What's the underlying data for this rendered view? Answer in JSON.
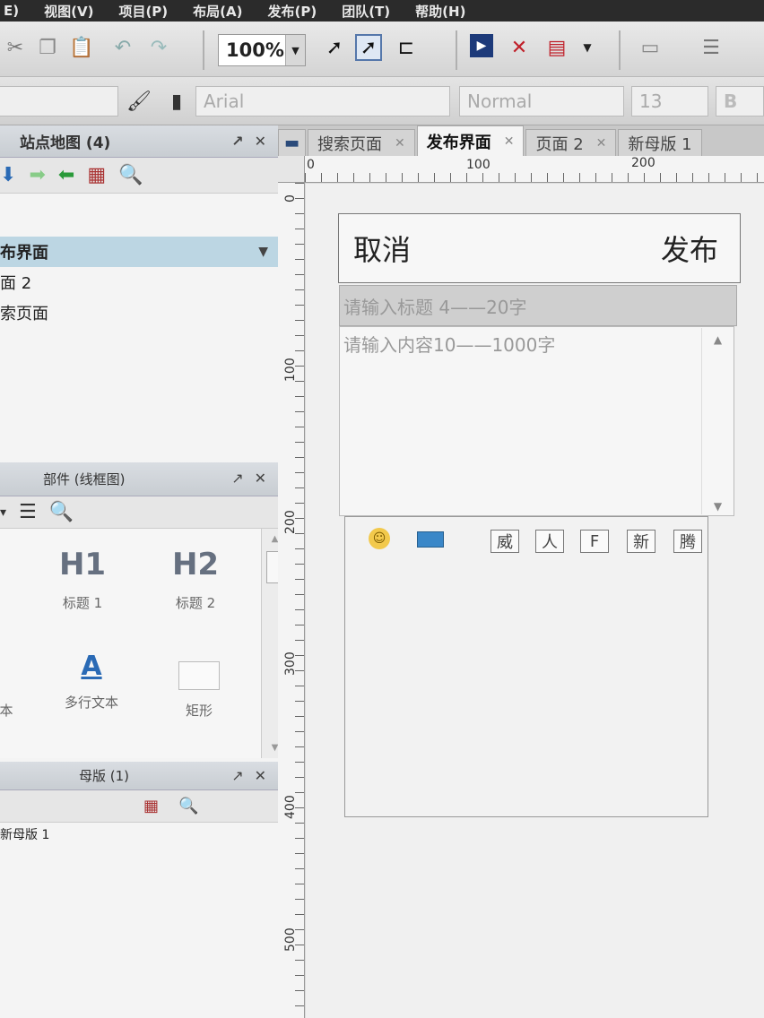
{
  "menu": [
    "E)",
    "视图(V)",
    "项目(P)",
    "布局(A)",
    "发布(P)",
    "团队(T)",
    "帮助(H)"
  ],
  "toolbar": {
    "zoom_value": "100%",
    "font_family_placeholder": "Arial",
    "font_style_placeholder": "Normal",
    "font_size_placeholder": "13",
    "bold_label": "B"
  },
  "sitemap": {
    "title": "站点地图 (4)",
    "items": [
      {
        "label": "布界面",
        "selected": true
      },
      {
        "label": "面 2",
        "selected": false
      },
      {
        "label": "索页面",
        "selected": false
      }
    ]
  },
  "widgets": {
    "title": "部件 (线框图)",
    "items": [
      {
        "icon": "H1",
        "label": "标题 1"
      },
      {
        "icon": "H2",
        "label": "标题 2"
      },
      {
        "icon": "",
        "label": "本"
      },
      {
        "icon": "A",
        "label": "多行文本"
      },
      {
        "icon": "",
        "label": "矩形"
      }
    ]
  },
  "masters": {
    "title": "母版 (1)",
    "items": [
      "新母版 1"
    ]
  },
  "tabs": [
    {
      "label": "搜索页面",
      "active": false
    },
    {
      "label": "发布界面",
      "active": true
    },
    {
      "label": "页面 2",
      "active": false
    },
    {
      "label": "新母版 1",
      "active": false
    }
  ],
  "ruler": {
    "top": [
      "0",
      "100",
      "200"
    ],
    "left": [
      "0",
      "100",
      "200",
      "300",
      "400",
      "500"
    ]
  },
  "mockup": {
    "cancel": "取消",
    "publish": "发布",
    "title_placeholder": "请输入标题 4——20字",
    "content_placeholder": "请输入内容10——1000字",
    "format_buttons": [
      "威",
      "人",
      "F",
      "新",
      "腾"
    ]
  }
}
